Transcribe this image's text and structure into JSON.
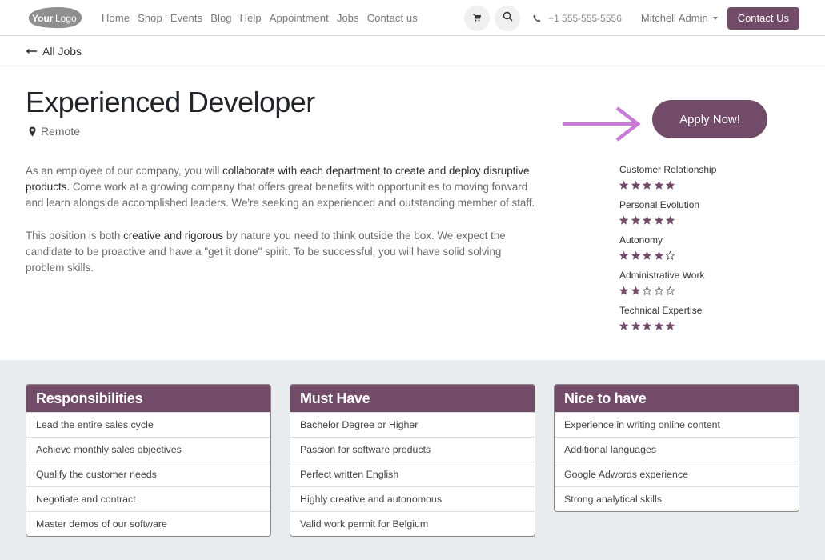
{
  "header": {
    "logo_text": "YourLogo",
    "nav": [
      "Home",
      "Shop",
      "Events",
      "Blog",
      "Help",
      "Appointment",
      "Jobs",
      "Contact us"
    ],
    "icons": {
      "cart": "cart-icon",
      "search": "search-icon",
      "phone": "phone-icon"
    },
    "phone": "+1 555-555-5556",
    "user": "Mitchell Admin",
    "contact_button": "Contact Us"
  },
  "breadcrumb": {
    "back_label": "All Jobs"
  },
  "job": {
    "title": "Experienced Developer",
    "location": "Remote",
    "apply_button": "Apply Now!",
    "paragraphs": [
      {
        "p1": "As an employee of our company, you will ",
        "b1": "collaborate with each department to create and deploy disruptive products.",
        "p2": " Come work at a growing company that offers great benefits with opportunities to moving forward and learn alongside accomplished leaders. We're seeking an experienced and outstanding member of staff."
      },
      {
        "p1": "This position is both ",
        "b1": "creative and rigorous",
        "p2": " by nature you need to think outside the box. We expect the candidate to be proactive and have a \"get it done\" spirit. To be successful, you will have solid solving problem skills."
      }
    ],
    "skills": [
      {
        "name": "Customer Relationship",
        "rating": 5,
        "max": 5
      },
      {
        "name": "Personal Evolution",
        "rating": 5,
        "max": 5
      },
      {
        "name": "Autonomy",
        "rating": 4,
        "max": 5
      },
      {
        "name": "Administrative Work",
        "rating": 2,
        "max": 5
      },
      {
        "name": "Technical Expertise",
        "rating": 5,
        "max": 5
      }
    ]
  },
  "cards": [
    {
      "title": "Responsibilities",
      "items": [
        "Lead the entire sales cycle",
        "Achieve monthly sales objectives",
        "Qualify the customer needs",
        "Negotiate and contract",
        "Master demos of our software"
      ]
    },
    {
      "title": "Must Have",
      "items": [
        "Bachelor Degree or Higher",
        "Passion for software products",
        "Perfect written English",
        "Highly creative and autonomous",
        "Valid work permit for Belgium"
      ]
    },
    {
      "title": "Nice to have",
      "items": [
        "Experience in writing online content",
        "Additional languages",
        "Google Adwords experience",
        "Strong analytical skills"
      ]
    }
  ],
  "colors": {
    "brand": "#714b67",
    "annotation_arrow": "#c77dd6",
    "lower_bg": "#e9ecef"
  }
}
